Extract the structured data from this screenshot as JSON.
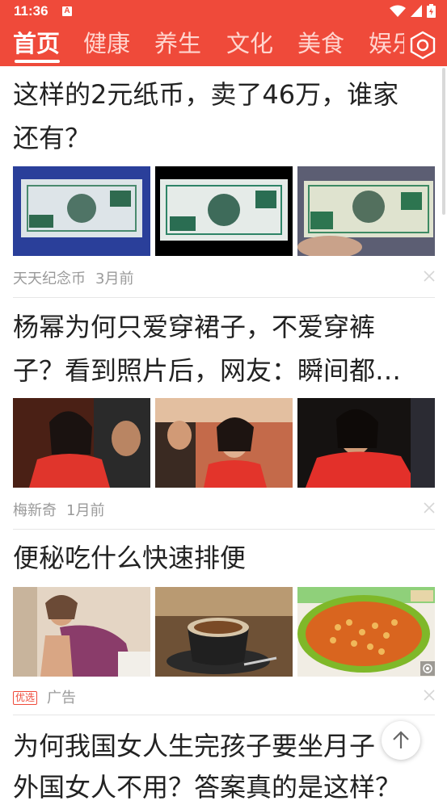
{
  "status_bar": {
    "time": "11:36",
    "badge": "A",
    "icons": [
      "wifi-icon",
      "signal-icon",
      "battery-icon"
    ]
  },
  "tabs": [
    {
      "label": "首页",
      "active": true
    },
    {
      "label": "健康",
      "active": false
    },
    {
      "label": "养生",
      "active": false
    },
    {
      "label": "文化",
      "active": false
    },
    {
      "label": "美食",
      "active": false
    },
    {
      "label": "娱乐",
      "active": false
    }
  ],
  "articles": [
    {
      "title_lines": [
        "这样的2元纸币，卖了46万，谁家",
        "还有？"
      ],
      "source": "天天纪念币",
      "time": "3月前"
    },
    {
      "title_lines": [
        "杨幂为何只爱穿裙子，不爱穿裤",
        "子？看到照片后，网友：瞬间都…"
      ],
      "source": "梅新奇",
      "time": "1月前"
    },
    {
      "title_lines": [
        "便秘吃什么快速排便"
      ],
      "ad_badge": "优选",
      "ad_label": "广告"
    },
    {
      "title_lines": [
        "为何我国女人生完孩子要坐月子",
        "外国女人不用？答案真的是这样？"
      ]
    }
  ],
  "colors": {
    "accent": "#ef4a3a",
    "title_text": "#222222",
    "meta_text": "#9a9a9a"
  }
}
